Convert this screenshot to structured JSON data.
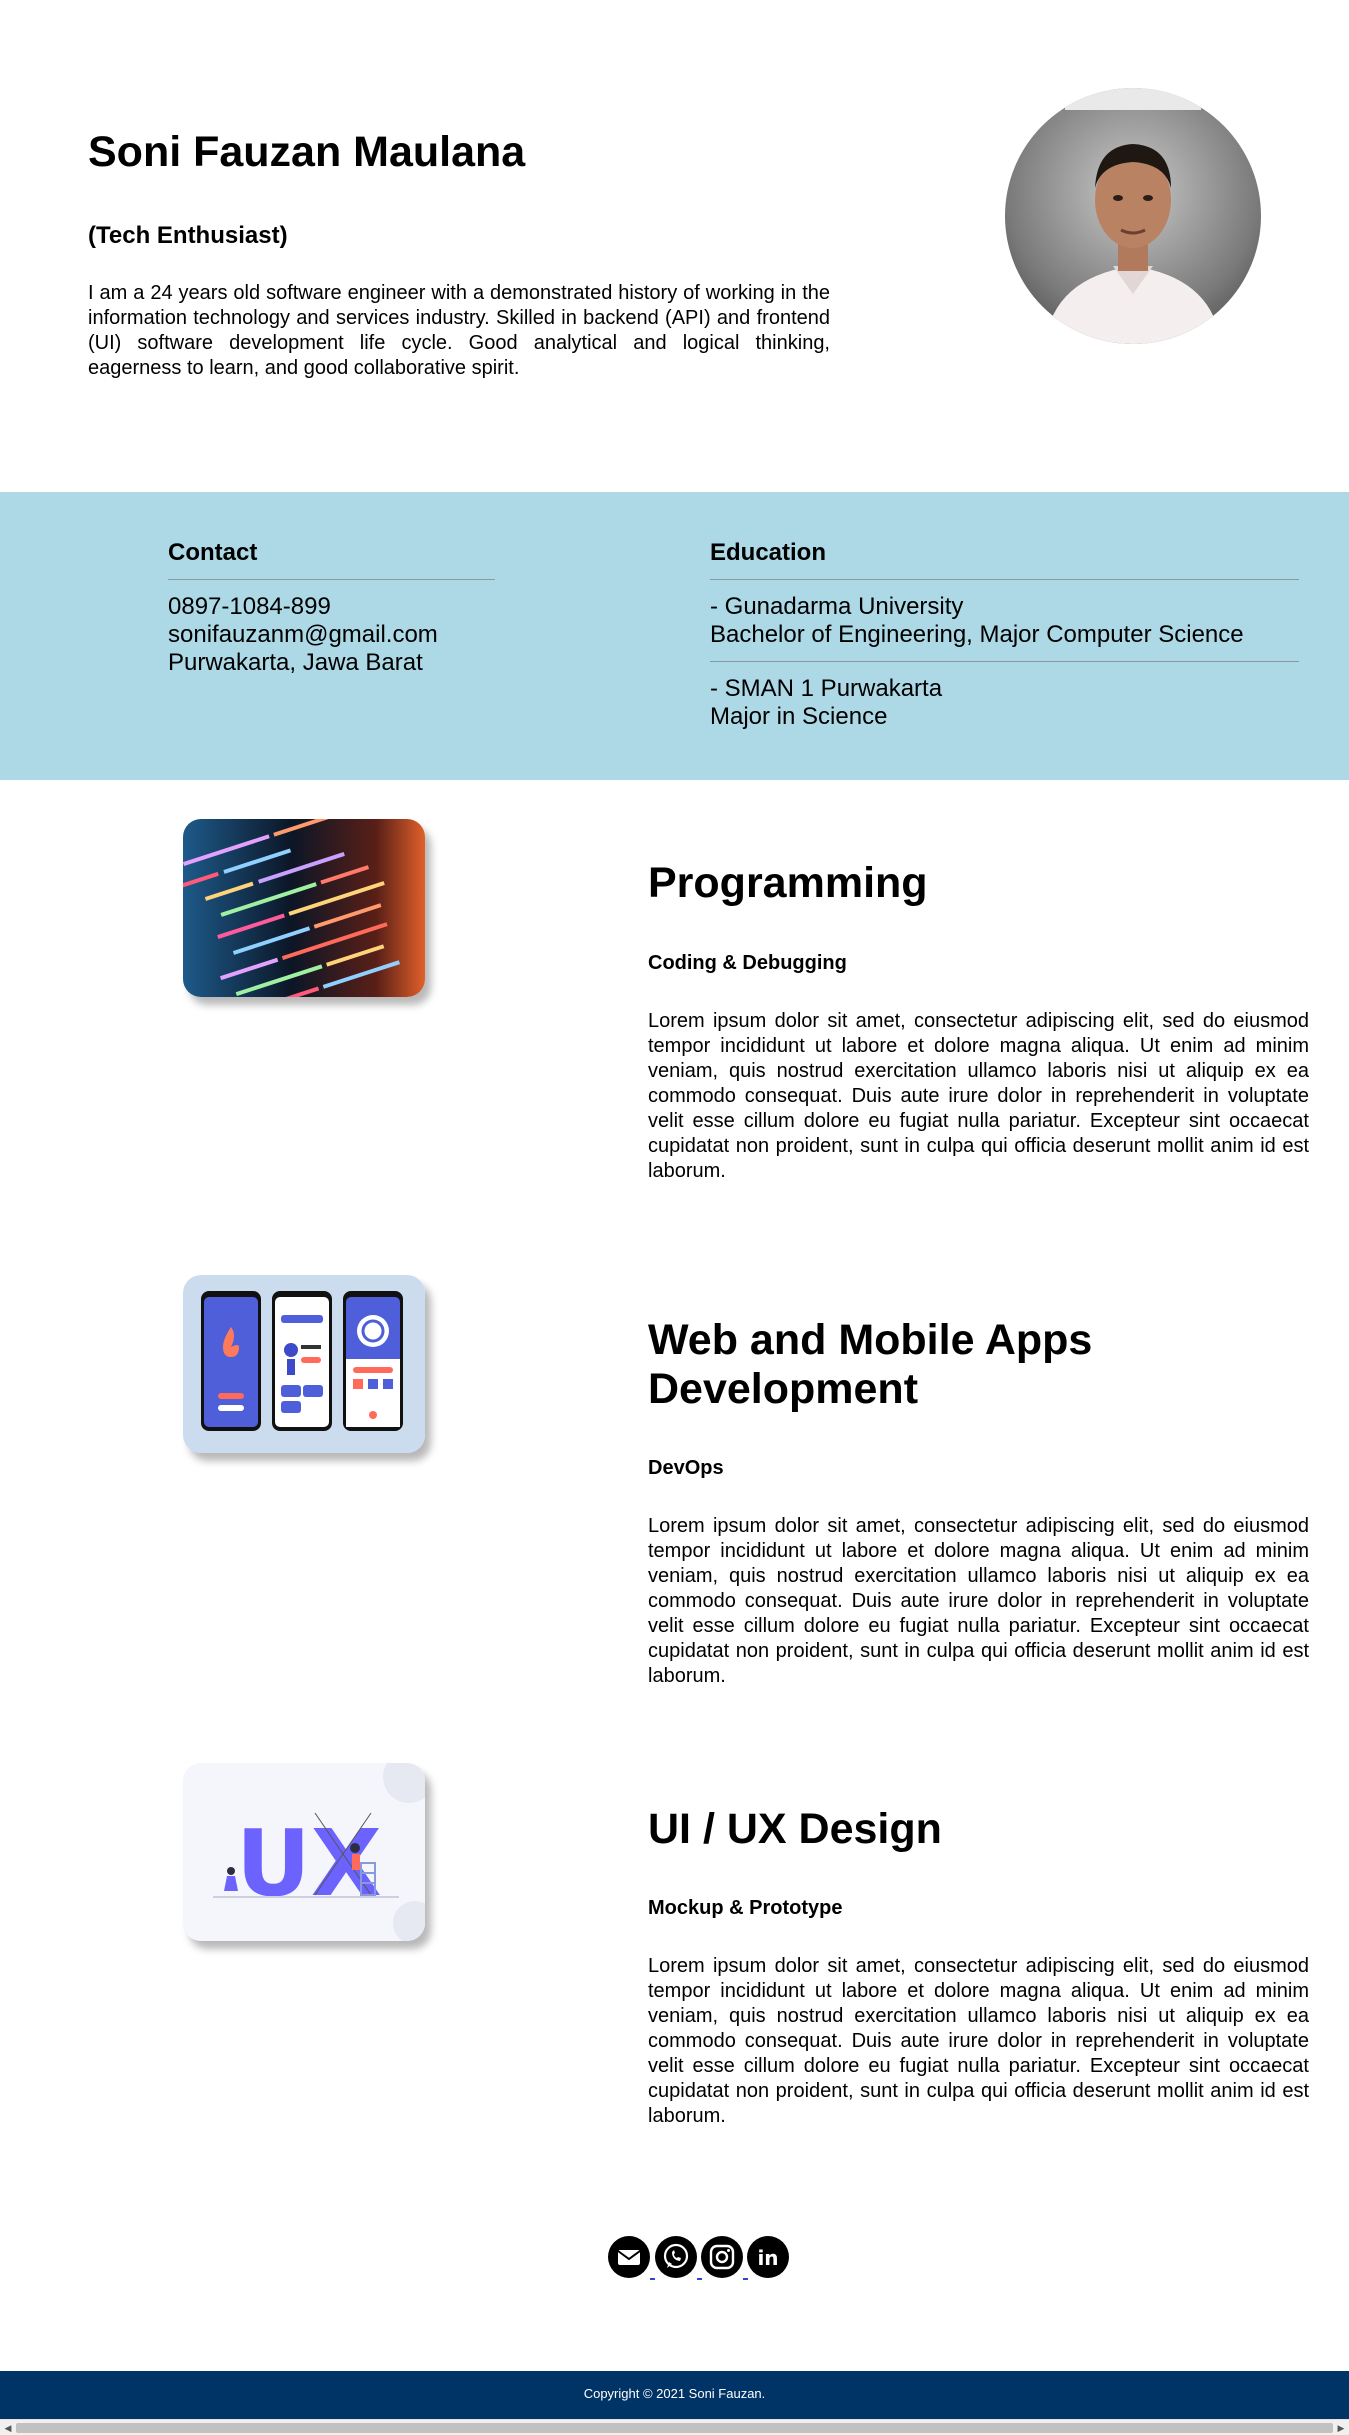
{
  "colors": {
    "band_bg": "#add8e6",
    "footer_bg": "#003366",
    "text": "#000000",
    "footer_text": "#ffffff"
  },
  "hero": {
    "name": "Soni Fauzan Maulana",
    "role": "(Tech Enthusiast)",
    "bio": "I am a 24 years old software engineer with a demonstrated history of working in the information technology and services industry. Skilled in backend (API) and frontend (UI) software development life cycle. Good analytical and logical thinking, eagerness to learn, and good collaborative spirit."
  },
  "contact": {
    "title": "Contact",
    "phone": "0897-1084-899",
    "email": "sonifauzanm@gmail.com",
    "location": "Purwakarta, Jawa Barat"
  },
  "education": {
    "title": "Education",
    "items": [
      {
        "school": "- Gunadarma University",
        "detail": "Bachelor of Engineering, Major Computer Science"
      },
      {
        "school": "- SMAN 1 Purwakarta",
        "detail": "Major in Science"
      }
    ]
  },
  "services": [
    {
      "title": "Programming",
      "subtitle": "Coding & Debugging",
      "body": "Lorem ipsum dolor sit amet, consectetur adipiscing elit, sed do eiusmod tempor incididunt ut labore et dolore magna aliqua. Ut enim ad minim veniam, quis nostrud exercitation ullamco laboris nisi ut aliquip ex ea commodo consequat. Duis aute irure dolor in reprehenderit in voluptate velit esse cillum dolore eu fugiat nulla pariatur. Excepteur sint occaecat cupidatat non proident, sunt in culpa qui officia deserunt mollit anim id est laborum.",
      "image_icon": "code-screen-image"
    },
    {
      "title": "Web and Mobile Apps Development",
      "subtitle": "DevOps",
      "body": "Lorem ipsum dolor sit amet, consectetur adipiscing elit, sed do eiusmod tempor incididunt ut labore et dolore magna aliqua. Ut enim ad minim veniam, quis nostrud exercitation ullamco laboris nisi ut aliquip ex ea commodo consequat. Duis aute irure dolor in reprehenderit in voluptate velit esse cillum dolore eu fugiat nulla pariatur. Excepteur sint occaecat cupidatat non proident, sunt in culpa qui officia deserunt mollit anim id est laborum.",
      "image_icon": "mobile-apps-image"
    },
    {
      "title": "UI / UX Design",
      "subtitle": "Mockup & Prototype",
      "body": "Lorem ipsum dolor sit amet, consectetur adipiscing elit, sed do eiusmod tempor incididunt ut labore et dolore magna aliqua. Ut enim ad minim veniam, quis nostrud exercitation ullamco laboris nisi ut aliquip ex ea commodo consequat. Duis aute irure dolor in reprehenderit in voluptate velit esse cillum dolore eu fugiat nulla pariatur. Excepteur sint occaecat cupidatat non proident, sunt in culpa qui officia deserunt mollit anim id est laborum.",
      "image_icon": "ux-illustration-image",
      "image_letters": "UX"
    }
  ],
  "social": [
    {
      "icon": "email-icon"
    },
    {
      "icon": "whatsapp-icon"
    },
    {
      "icon": "instagram-icon"
    },
    {
      "icon": "linkedin-icon",
      "glyph": "in"
    }
  ],
  "footer": {
    "copyright": "Copyright © 2021 Soni Fauzan."
  }
}
